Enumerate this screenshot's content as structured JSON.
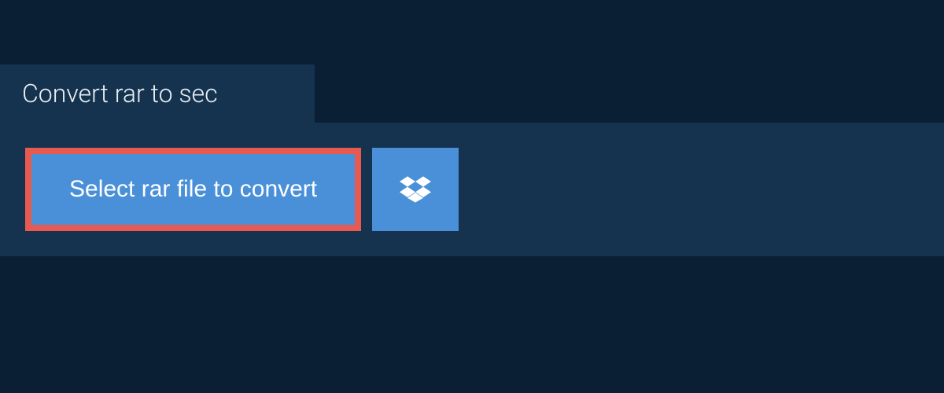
{
  "tab": {
    "title": "Convert rar to sec"
  },
  "upload": {
    "select_button_label": "Select rar file to convert"
  },
  "colors": {
    "background": "#0a1f33",
    "panel": "#15334f",
    "button": "#4a90d9",
    "highlight_border": "#e85a4f"
  }
}
